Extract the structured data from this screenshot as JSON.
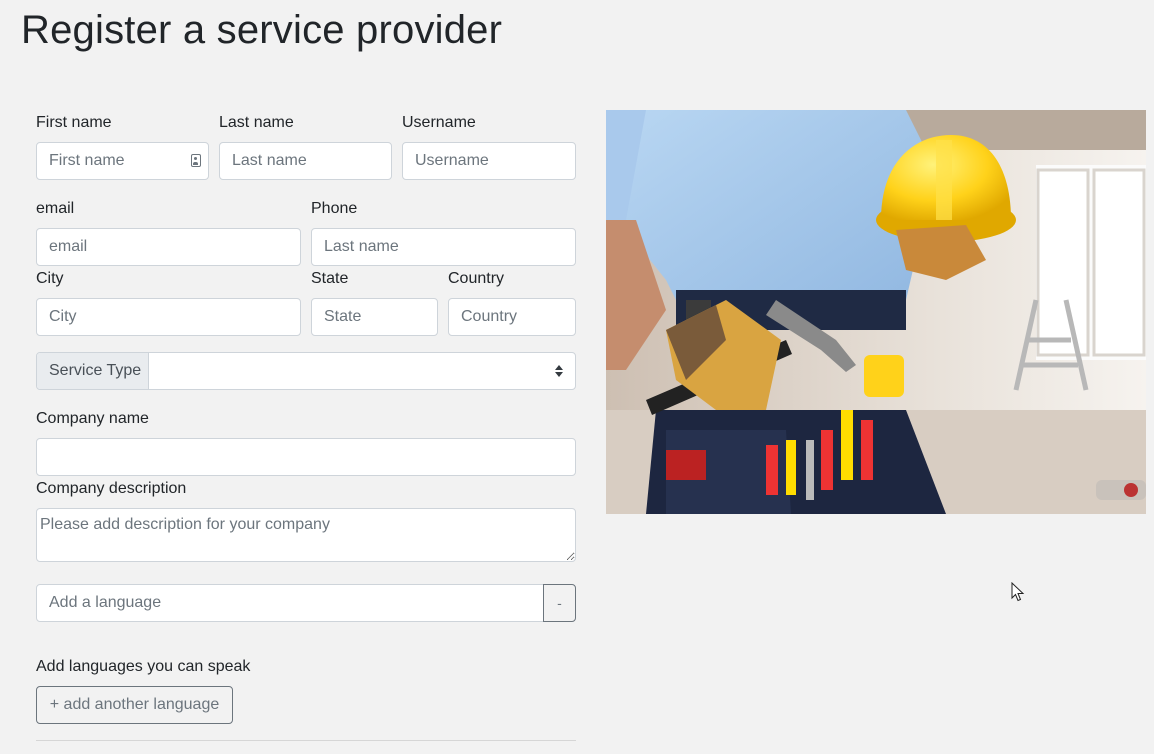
{
  "page": {
    "title": "Register a service provider"
  },
  "form": {
    "first_name": {
      "label": "First name",
      "placeholder": "First name"
    },
    "last_name": {
      "label": "Last name",
      "placeholder": "Last name"
    },
    "username": {
      "label": "Username",
      "placeholder": "Username"
    },
    "email": {
      "label": "email",
      "placeholder": "email"
    },
    "phone": {
      "label": "Phone",
      "placeholder": "Last name"
    },
    "city": {
      "label": "City",
      "placeholder": "City"
    },
    "state": {
      "label": "State",
      "placeholder": "State"
    },
    "country": {
      "label": "Country",
      "placeholder": "Country"
    },
    "service_type": {
      "label": "Service Type",
      "value": ""
    },
    "company_name": {
      "label": "Company name",
      "placeholder": ""
    },
    "company_description": {
      "label": "Company description",
      "placeholder": "Please add description for your company"
    },
    "language": {
      "placeholder": "Add a language",
      "remove_label": "-"
    },
    "languages_section": {
      "label": "Add languages you can speak",
      "add_button": "+ add another language"
    }
  },
  "image": {
    "subject": "worker-with-tool-belt-and-hard-hat",
    "colors": {
      "shirt": "#9fc4ea",
      "helmet": "#ffd21a",
      "belt": "#1f2a44",
      "glove": "#d9a441"
    }
  }
}
